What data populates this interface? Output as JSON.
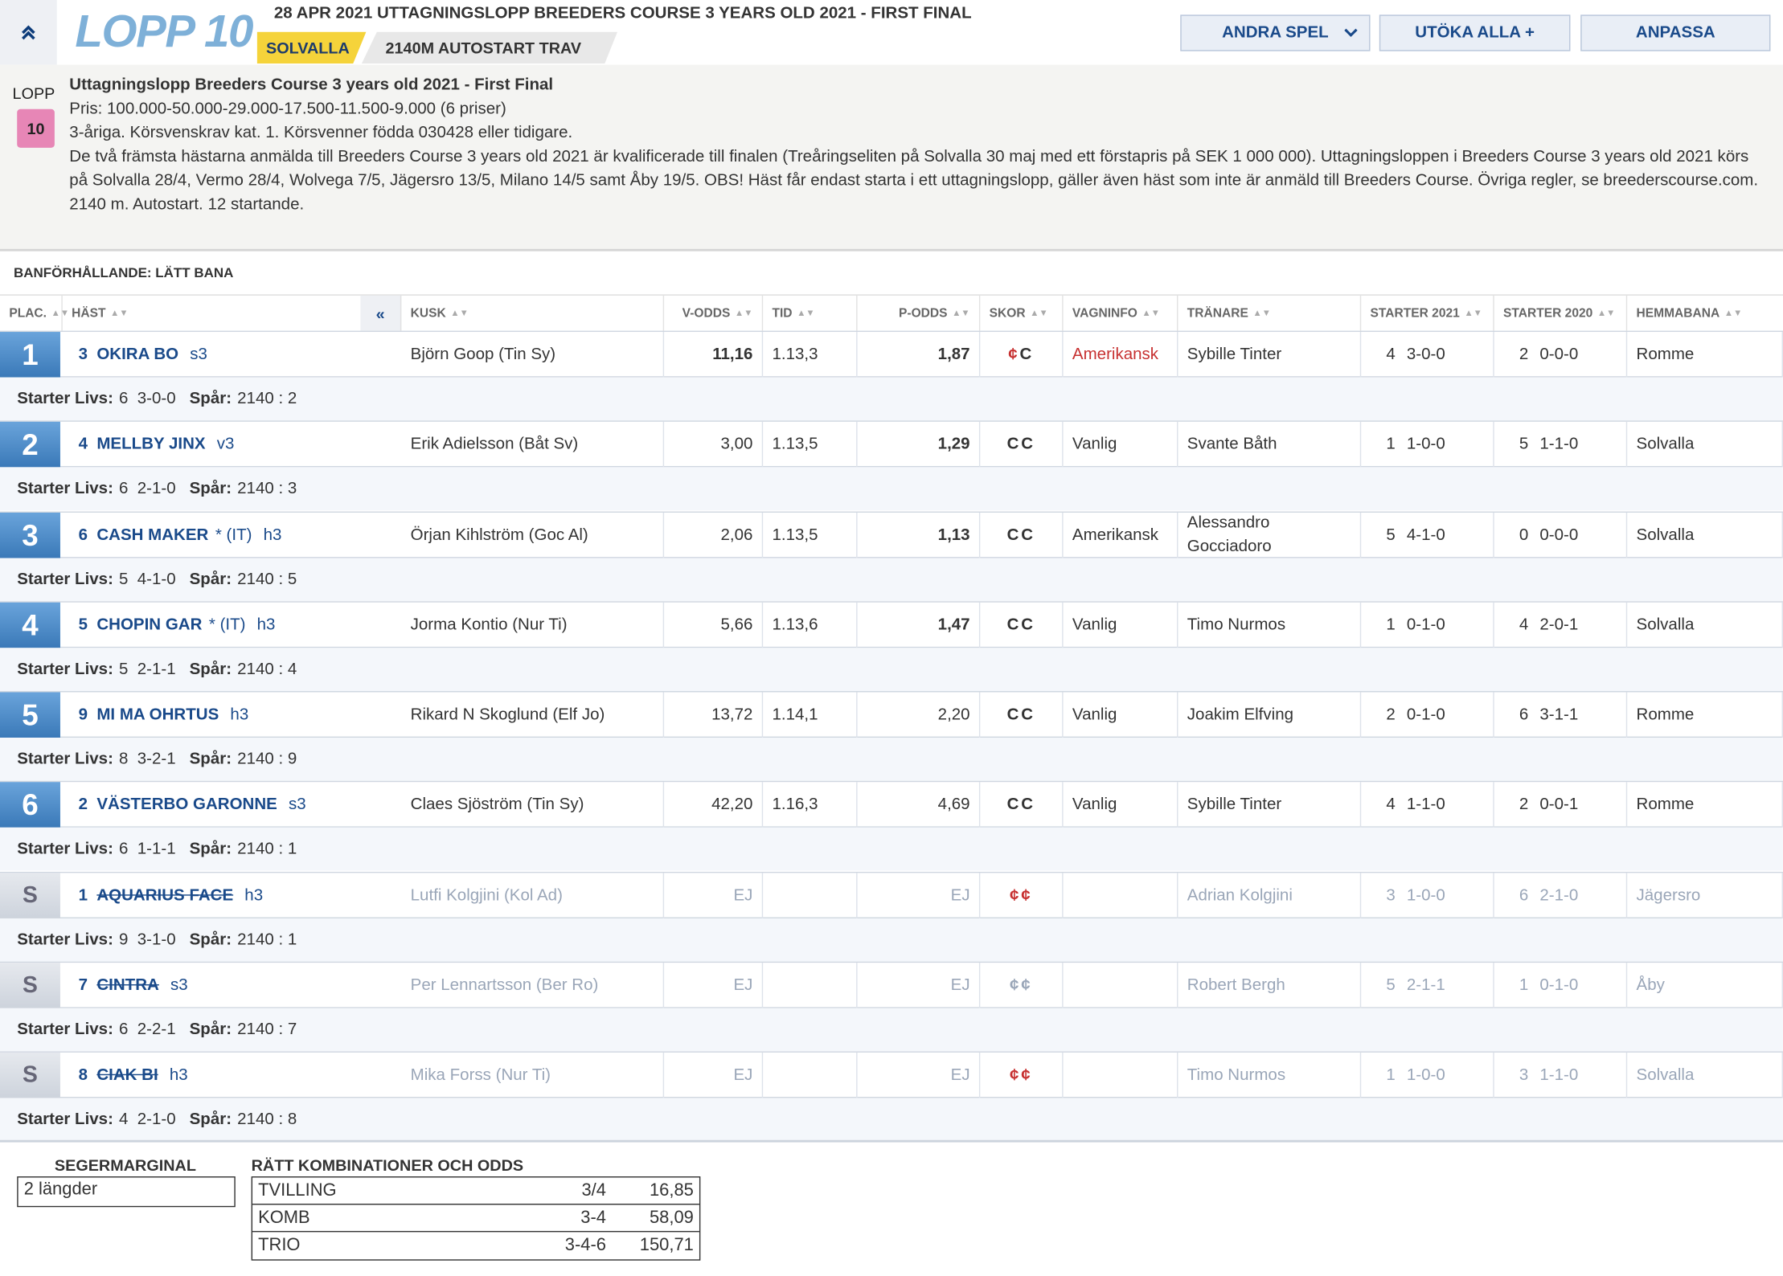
{
  "header": {
    "race_label": "LOPP 10",
    "race_title": "28 APR 2021 UTTAGNINGSLOPP BREEDERS COURSE 3 YEARS OLD 2021 - FIRST FINAL",
    "track": "SOLVALLA",
    "start_info": "2140M AUTOSTART TRAV",
    "buttons": {
      "andra": "ANDRA SPEL",
      "utoka": "UTÖKA ALLA +",
      "anpassa": "ANPASSA"
    }
  },
  "info": {
    "lopp_label": "LOPP",
    "lopp_number": "10",
    "badge_color": "#e786b6",
    "title": "Uttagningslopp Breeders Course 3 years old 2021 - First Final",
    "prize": "Pris: 100.000-50.000-29.000-17.500-11.500-9.000 (6 priser)",
    "line2": "3-åriga. Körsvenskrav kat. 1. Körsvenner födda 030428 eller tidigare.",
    "line3": "De två främsta hästarna anmälda till Breeders Course 3 years old 2021 är kvalificerade till finalen (Treåringseliten på Solvalla 30 maj med ett förstapris på SEK 1 000 000). Uttagningsloppen i Breeders Course 3 years old 2021 körs på Solvalla 28/4, Vermo 28/4, Wolvega 7/5, Jägersro 13/5, Milano 14/5 samt Åby 19/5. OBS! Häst får endast starta i ett uttagningslopp, gäller även häst som inte är anmäld till Breeders Course. Övriga regler, se breederscourse.com.",
    "line4": "2140 m. Autostart. 12 startande."
  },
  "condition": "BANFÖRHÅLLANDE: LÄTT BANA",
  "columns": {
    "plac": "PLAC.",
    "hast": "HÄST",
    "kusk": "KUSK",
    "vodds": "V-ODDS",
    "tid": "TID",
    "podds": "P-ODDS",
    "skor": "SKOR",
    "vagn": "VAGNINFO",
    "tranare": "TRÄNARE",
    "s2021": "STARTER 2021",
    "s2020": "STARTER 2020",
    "hem": "HEMMABANA",
    "collapse": "«"
  },
  "sub_labels": {
    "starter": "Starter Livs:",
    "spar": "Spår:"
  },
  "rows": [
    {
      "place": "1",
      "no": "3",
      "name": "OKIRA BO",
      "extra": "",
      "age": "s3",
      "driver": "Björn Goop (Tin Sy)",
      "vodds": "11,16",
      "tid": "1.13,3",
      "podds": "1,87",
      "skor": "¢C",
      "vagn": "Amerikansk",
      "tranare": "Sybille Tinter",
      "s21n": "4",
      "s21r": "3-0-0",
      "s20n": "2",
      "s20r": "0-0-0",
      "hem": "Romme",
      "livs_n": "6",
      "livs_r": "3-0-0",
      "spar": "2140 : 2"
    },
    {
      "place": "2",
      "no": "4",
      "name": "MELLBY JINX",
      "extra": "",
      "age": "v3",
      "driver": "Erik Adielsson (Båt Sv)",
      "vodds": "3,00",
      "tid": "1.13,5",
      "podds": "1,29",
      "skor": "CC",
      "vagn": "Vanlig",
      "tranare": "Svante Båth",
      "s21n": "1",
      "s21r": "1-0-0",
      "s20n": "5",
      "s20r": "1-1-0",
      "hem": "Solvalla",
      "livs_n": "6",
      "livs_r": "2-1-0",
      "spar": "2140 : 3"
    },
    {
      "place": "3",
      "no": "6",
      "name": "CASH MAKER",
      "extra": "* (IT)",
      "age": "h3",
      "driver": "Örjan Kihlström (Goc Al)",
      "vodds": "2,06",
      "tid": "1.13,5",
      "podds": "1,13",
      "skor": "CC",
      "vagn": "Amerikansk",
      "tranare": "Alessandro Gocciadoro",
      "s21n": "5",
      "s21r": "4-1-0",
      "s20n": "0",
      "s20r": "0-0-0",
      "hem": "Solvalla",
      "livs_n": "5",
      "livs_r": "4-1-0",
      "spar": "2140 : 5"
    },
    {
      "place": "4",
      "no": "5",
      "name": "CHOPIN GAR",
      "extra": "* (IT)",
      "age": "h3",
      "driver": "Jorma Kontio (Nur Ti)",
      "vodds": "5,66",
      "tid": "1.13,6",
      "podds": "1,47",
      "skor": "CC",
      "vagn": "Vanlig",
      "tranare": "Timo Nurmos",
      "s21n": "1",
      "s21r": "0-1-0",
      "s20n": "4",
      "s20r": "2-0-1",
      "hem": "Solvalla",
      "livs_n": "5",
      "livs_r": "2-1-1",
      "spar": "2140 : 4"
    },
    {
      "place": "5",
      "no": "9",
      "name": "MI MA OHRTUS",
      "extra": "",
      "age": "h3",
      "driver": "Rikard N Skoglund (Elf Jo)",
      "vodds": "13,72",
      "tid": "1.14,1",
      "podds": "2,20",
      "skor": "CC",
      "vagn": "Vanlig",
      "tranare": "Joakim Elfving",
      "s21n": "2",
      "s21r": "0-1-0",
      "s20n": "6",
      "s20r": "3-1-1",
      "hem": "Romme",
      "livs_n": "8",
      "livs_r": "3-2-1",
      "spar": "2140 : 9"
    },
    {
      "place": "6",
      "no": "2",
      "name": "VÄSTERBO GARONNE",
      "extra": "",
      "age": "s3",
      "driver": "Claes Sjöström (Tin Sy)",
      "vodds": "42,20",
      "tid": "1.16,3",
      "podds": "4,69",
      "skor": "CC",
      "vagn": "Vanlig",
      "tranare": "Sybille Tinter",
      "s21n": "4",
      "s21r": "1-1-0",
      "s20n": "2",
      "s20r": "0-0-1",
      "hem": "Romme",
      "livs_n": "6",
      "livs_r": "1-1-1",
      "spar": "2140 : 1"
    },
    {
      "place": "S",
      "no": "1",
      "name": "AQUARIUS FACE",
      "extra": "",
      "age": "h3",
      "driver": "Lutfi Kolgjini (Kol Ad)",
      "vodds": "EJ",
      "tid": "",
      "podds": "EJ",
      "skor": "¢¢",
      "vagn": "",
      "tranare": "Adrian Kolgjini",
      "s21n": "3",
      "s21r": "1-0-0",
      "s20n": "6",
      "s20r": "2-1-0",
      "hem": "Jägersro",
      "livs_n": "9",
      "livs_r": "3-1-0",
      "spar": "2140 : 1"
    },
    {
      "place": "S",
      "no": "7",
      "name": "CINTRA",
      "extra": "",
      "age": "s3",
      "driver": "Per Lennartsson (Ber Ro)",
      "vodds": "EJ",
      "tid": "",
      "podds": "EJ",
      "skor": "¢¢",
      "vagn": "",
      "tranare": "Robert Bergh",
      "s21n": "5",
      "s21r": "2-1-1",
      "s20n": "1",
      "s20r": "0-1-0",
      "hem": "Åby",
      "livs_n": "6",
      "livs_r": "2-2-1",
      "spar": "2140 : 7"
    },
    {
      "place": "S",
      "no": "8",
      "name": "CIAK BI",
      "extra": "",
      "age": "h3",
      "driver": "Mika Forss (Nur Ti)",
      "vodds": "EJ",
      "tid": "",
      "podds": "EJ",
      "skor": "¢¢",
      "vagn": "",
      "tranare": "Timo Nurmos",
      "s21n": "1",
      "s21r": "1-0-0",
      "s20n": "3",
      "s20r": "1-1-0",
      "hem": "Solvalla",
      "livs_n": "4",
      "livs_r": "2-1-0",
      "spar": "2140 : 8"
    }
  ],
  "footer": {
    "margin_label": "SEGERMARGINAL",
    "margin_value": "2 längder",
    "combo_label": "RÄTT KOMBINATIONER OCH ODDS",
    "combos": [
      {
        "type": "TVILLING",
        "komb": "3/4",
        "odds": "16,85"
      },
      {
        "type": "KOMB",
        "komb": "3-4",
        "odds": "58,09"
      },
      {
        "type": "TRIO",
        "komb": "3-4-6",
        "odds": "150,71"
      }
    ]
  },
  "colors": {
    "accent": "#1a4a8a",
    "place_blue": "#3a79b8",
    "track_yellow": "#f5d33a",
    "shoe_red": "#c73030"
  }
}
